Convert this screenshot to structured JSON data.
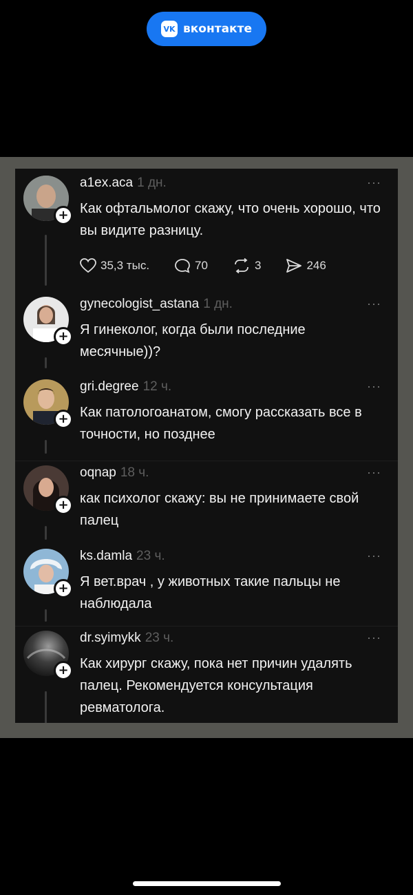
{
  "brand": {
    "name": "вконтакте",
    "logo_text": "VK",
    "color": "#1877f2"
  },
  "post": {
    "author": "a1ex.aca",
    "time": "1 дн.",
    "text": "Как офтальмолог скажу, что очень хорошо, что вы видите разницу.",
    "stats": {
      "likes": "35,3 тыс.",
      "comments": "70",
      "reposts": "3",
      "shares": "246"
    },
    "more": "···"
  },
  "replies": [
    {
      "author": "gynecologist_astana",
      "time": "1 дн.",
      "text": "Я гинеколог, когда были последние месячные))?",
      "more": "···"
    },
    {
      "author": "gri.degree",
      "time": "12 ч.",
      "text": "Как патологоанатом, смогу рассказать все в точности, но позднее",
      "more": "···"
    },
    {
      "author": "oqnap",
      "time": "18 ч.",
      "text": "как психолог скажу: вы не принимаете свой палец",
      "more": "···"
    },
    {
      "author": "ks.damla",
      "time": "23 ч.",
      "text": "Я вет.врач , у животных такие пальцы не наблюдала",
      "more": "···"
    },
    {
      "author": "dr.syimykk",
      "time": "23 ч.",
      "text": "Как хирург скажу, пока нет причин удалять палец. Рекомендуется консультация ревматолога.",
      "more": "···"
    }
  ],
  "follow_symbol": "+"
}
